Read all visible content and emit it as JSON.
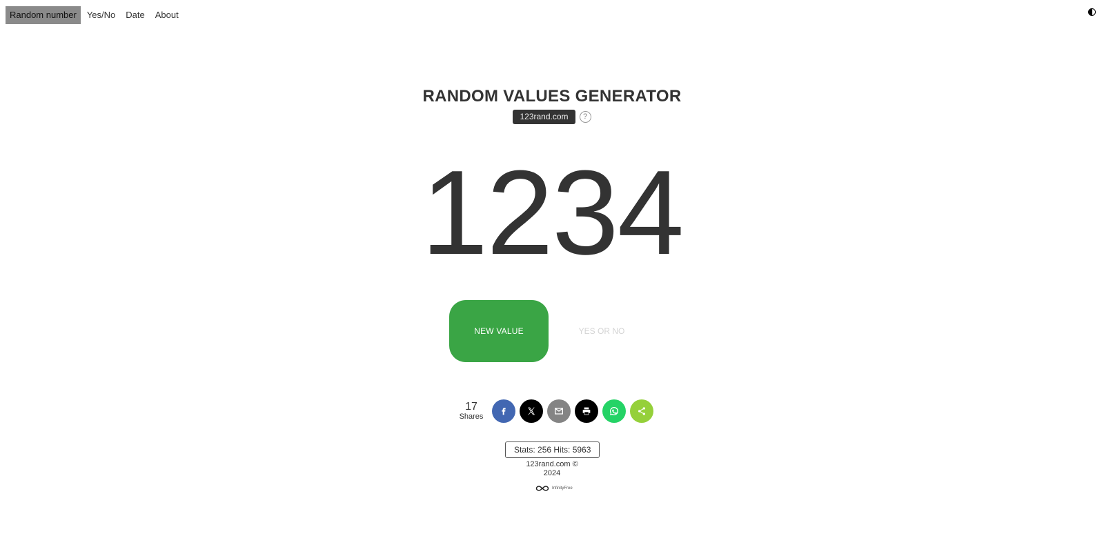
{
  "nav": {
    "items": [
      {
        "label": "Random number",
        "active": true
      },
      {
        "label": "Yes/No",
        "active": false
      },
      {
        "label": "Date",
        "active": false
      },
      {
        "label": "About",
        "active": false
      }
    ],
    "theme_toggle_icon": "half-moon-icon"
  },
  "header": {
    "title": "RANDOM VALUES GENERATOR",
    "domain_badge": "123rand.com",
    "help_icon_text": "?"
  },
  "result": {
    "value": "1234"
  },
  "buttons": {
    "new_value": "NEW VALUE",
    "yes_or_no": "YES OR NO"
  },
  "share": {
    "count": "17",
    "count_label": "Shares",
    "buttons": [
      {
        "name": "facebook",
        "icon": "facebook-icon",
        "color": "#4267b2"
      },
      {
        "name": "x",
        "icon": "x-icon",
        "color": "#000000"
      },
      {
        "name": "email",
        "icon": "email-icon",
        "color": "#848484"
      },
      {
        "name": "print",
        "icon": "print-icon",
        "color": "#000000"
      },
      {
        "name": "whatsapp",
        "icon": "whatsapp-icon",
        "color": "#25d366"
      },
      {
        "name": "sharethis",
        "icon": "share-icon",
        "color": "#95d03a"
      }
    ]
  },
  "stats": {
    "text": "Stats: 256 Hits: 5963"
  },
  "footer": {
    "copyright_line1": "123rand.com ©",
    "copyright_line2": "2024",
    "host_logo_text": "InfinityFree"
  },
  "colors": {
    "accent_green": "#3aa545",
    "nav_active_bg": "#8a8a8a",
    "text": "#333333"
  }
}
